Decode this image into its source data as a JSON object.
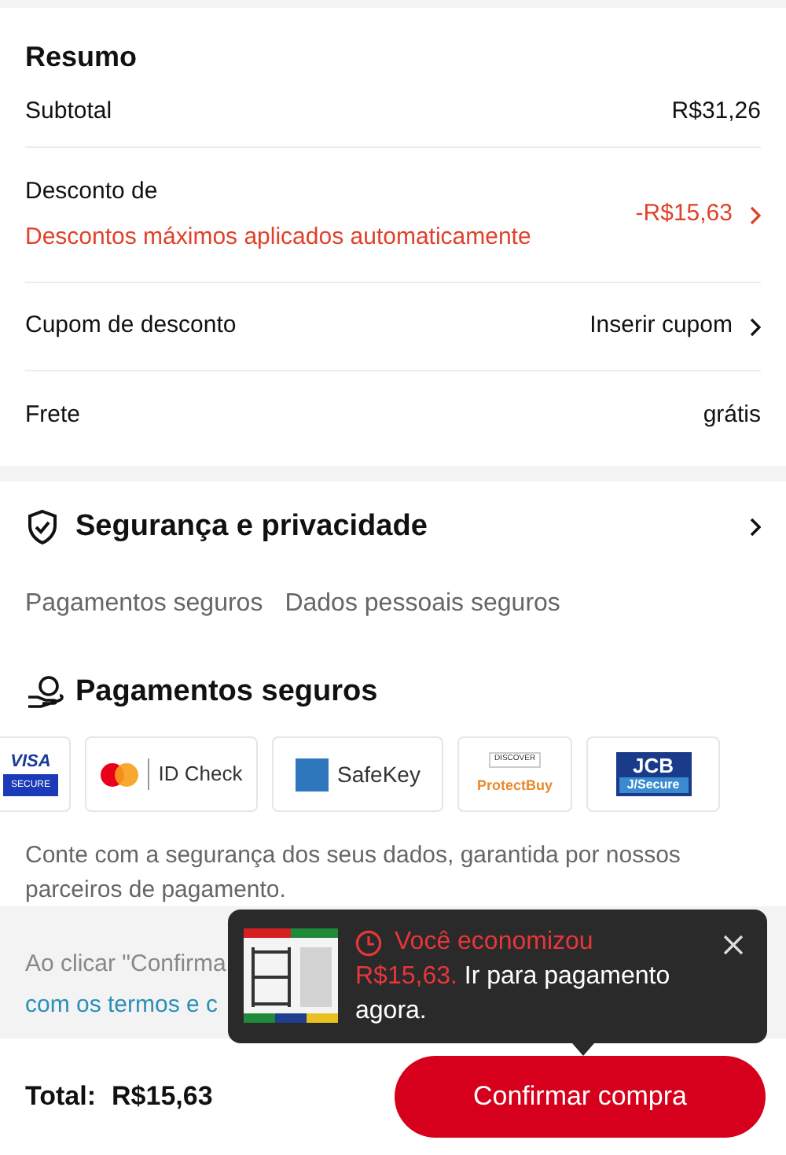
{
  "summary": {
    "title": "Resumo",
    "rows": [
      {
        "kind": "plain",
        "label": "Subtotal",
        "value": "R$31,26"
      },
      {
        "kind": "discount",
        "label": "Desconto de",
        "note": "Descontos máximos aplicados automaticamente",
        "value": "-R$15,63",
        "chevron": true
      },
      {
        "kind": "plain",
        "label": "Cupom de desconto",
        "value": "Inserir cupom",
        "chevron": true
      },
      {
        "kind": "plain",
        "label": "Frete",
        "value": "grátis"
      }
    ]
  },
  "security": {
    "title": "Segurança e privacidade",
    "tags": [
      "Pagamentos seguros",
      "Dados pessoais seguros"
    ],
    "payments_title": "Pagamentos seguros",
    "badges": [
      {
        "kind": "visa",
        "texts": [
          "VISA",
          "SECURE"
        ]
      },
      {
        "kind": "mastercard",
        "texts": [
          "ID Check"
        ]
      },
      {
        "kind": "amex",
        "texts": [
          "SafeKey"
        ]
      },
      {
        "kind": "discover",
        "texts": [
          "DISCOVER",
          "ProtectBuy"
        ]
      },
      {
        "kind": "jcb",
        "texts": [
          "JCB",
          "J/Secure"
        ]
      }
    ],
    "note": "Conte com a segurança dos seus dados, garantida por nossos parceiros de pagamento."
  },
  "terms": {
    "line_1": "Ao clicar \"Confirma",
    "link": "com os termos e c"
  },
  "popup": {
    "title": "Você economizou",
    "amount": "R$15,63.",
    "message": "Ir para pagamento agora."
  },
  "footer": {
    "total_label": "Total:",
    "total": "R$15,63",
    "button": "Confirmar compra"
  }
}
